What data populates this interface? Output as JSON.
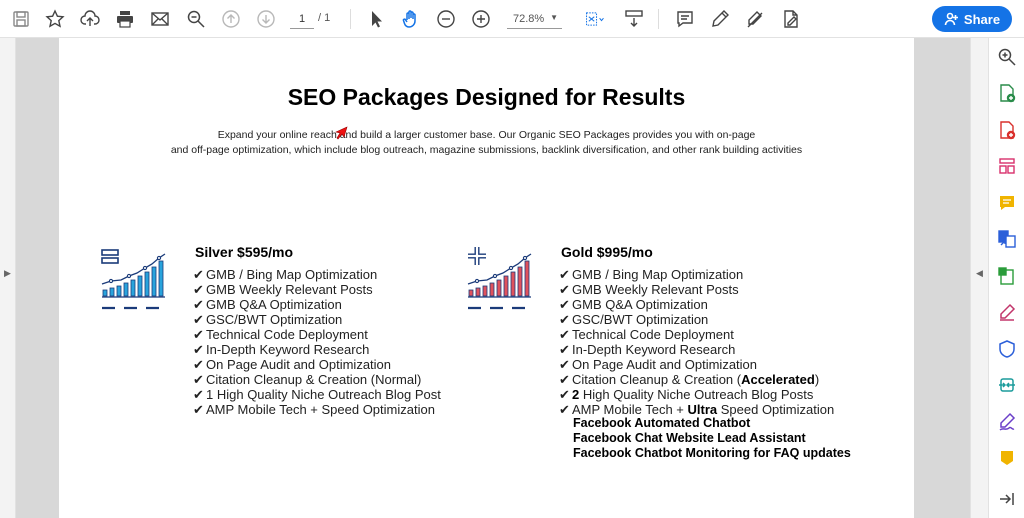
{
  "toolbar": {
    "page_current": "1",
    "page_total": "/ 1",
    "zoom": "72.8%",
    "share_label": "Share",
    "icons": [
      "save-icon",
      "bookmark-star-icon",
      "upload-cloud-icon",
      "print-icon",
      "email-icon",
      "zoom-search-icon",
      "page-up-icon",
      "page-down-icon",
      "select-pointer-icon",
      "hand-tool-icon",
      "zoom-out-icon",
      "zoom-in-icon",
      "fit-page-icon",
      "scroll-mode-icon",
      "comment-icon",
      "highlight-pen-icon",
      "sign-icon",
      "fill-sign-icon"
    ]
  },
  "document": {
    "title": "SEO Packages Designed for Results",
    "intro_line1": "Expand your online reach and build a larger customer base. Our Organic SEO Packages provides you with on-page",
    "intro_line2": "and off-page optimization, which include blog outreach, magazine submissions, backlink diversification, and other rank building activities",
    "silver": {
      "title": "Silver $595/mo",
      "items": [
        "GMB / Bing Map Optimization",
        "GMB Weekly Relevant Posts",
        "GMB Q&A Optimization",
        "GSC/BWT Optimization",
        "Technical Code Deployment",
        "In-Depth Keyword Research",
        "On Page Audit and Optimization",
        "Citation Cleanup & Creation (Normal)",
        "1 High Quality Niche Outreach Blog Post",
        "AMP Mobile Tech + Speed Optimization"
      ]
    },
    "gold": {
      "title": "Gold $995/mo",
      "items": [
        "GMB / Bing Map Optimization",
        "GMB Weekly Relevant Posts",
        "GMB Q&A Optimization",
        "GSC/BWT Optimization",
        "Technical Code Deployment",
        "In-Depth Keyword Research",
        "On Page Audit and Optimization"
      ],
      "item_citation_pre": "Citation Cleanup & Creation (",
      "item_citation_bold": "Accelerated",
      "item_citation_post": ")",
      "item_blog_bold": "2",
      "item_blog_post": " High Quality Niche Outreach Blog Posts",
      "item_amp_pre": "AMP Mobile Tech + ",
      "item_amp_bold": "Ultra",
      "item_amp_post": " Speed Optimization",
      "extras": [
        "Facebook Automated Chatbot",
        "Facebook Chat Website Lead Assistant",
        "Facebook Chatbot Monitoring for FAQ updates"
      ]
    },
    "check_glyph": "✔"
  },
  "colors": {
    "accent": "#1473e6",
    "silver_bars": "#29a3dc",
    "gold_bars": "#e0525c",
    "navy": "#1b3b7a"
  }
}
